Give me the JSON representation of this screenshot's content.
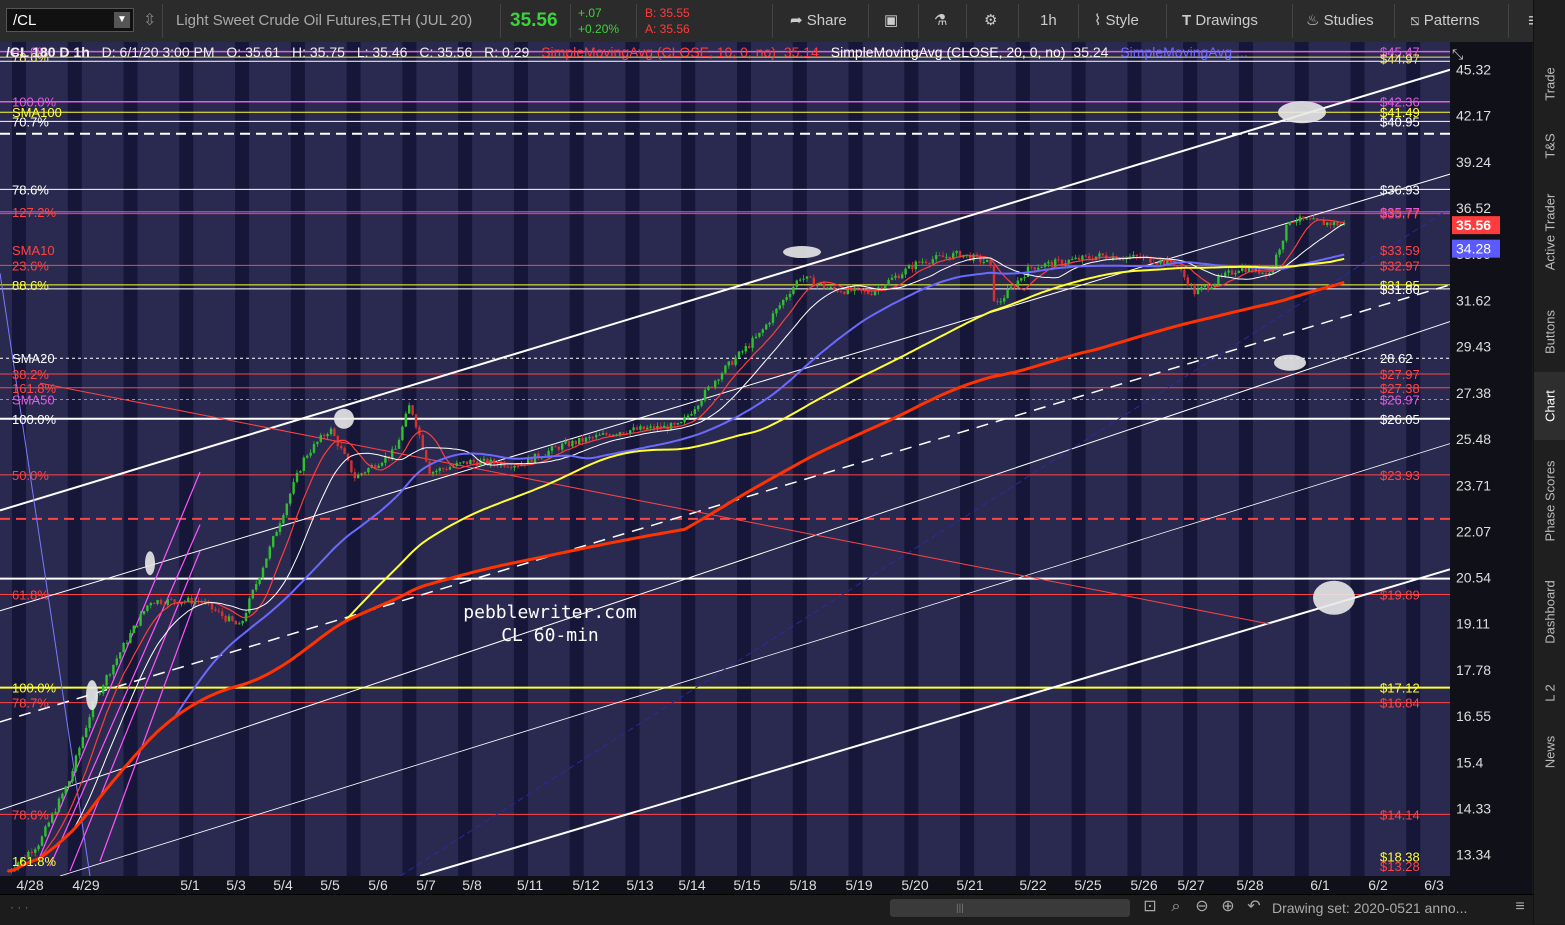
{
  "toolbar": {
    "symbol": "/CL",
    "instrument": "Light Sweet Crude Oil Futures,ETH (JUL 20)",
    "last": "35.56",
    "change": "+.07",
    "change_pct": "+0.20%",
    "bid": "B: 35.55",
    "ask": "A: 35.56",
    "share": "Share",
    "interval": "1h",
    "style": "Style",
    "drawings": "Drawings",
    "studies": "Studies",
    "patterns": "Patterns"
  },
  "header": {
    "title": "/CL 180 D 1h",
    "date": "D: 6/1/20 3:00 PM",
    "open": "O: 35.61",
    "high": "H: 35.75",
    "low": "L: 35.46",
    "close": "C: 35.56",
    "range": "R: 0.29",
    "sma10": "SimpleMovingAvg (CLOSE, 10, 0, no)",
    "sma10_val": "35.14",
    "sma20": "SimpleMovingAvg (CLOSE, 20, 0, no)",
    "sma20_val": "35.24",
    "sma_more": "SimpleMovingAvg ..."
  },
  "side_tabs": [
    "Trade",
    "T&S",
    "Active Trader",
    "Buttons",
    "Chart",
    "Phase Scores",
    "Dashboard",
    "L 2",
    "News"
  ],
  "watermark": {
    "line1": "pebblewriter.com",
    "line2": "CL 60-min"
  },
  "footer": {
    "drawing_set": "Drawing set: 2020-0521 anno..."
  },
  "colors": {
    "background": "#2a2a50",
    "candle_up": "#2fbf2f",
    "candle_down": "#d83030",
    "sma10": "#ff3b3b",
    "sma20": "#ffffff",
    "sma50": "#6a6aff",
    "sma100": "#ffff33",
    "sma200": "#ff3300",
    "last_price": "#ff3b3b",
    "sma_price": "#5a5aff"
  },
  "chart_data": {
    "type": "line",
    "ylim": [
      12.9,
      47.3
    ],
    "y_ticks": [
      45.32,
      42.17,
      39.24,
      36.52,
      33.99,
      31.62,
      29.43,
      27.38,
      25.48,
      23.71,
      22.07,
      20.54,
      19.11,
      17.78,
      16.55,
      15.4,
      14.33,
      13.34
    ],
    "x_ticks": [
      "4/28",
      "4/29",
      "5/1",
      "5/3",
      "5/4",
      "5/5",
      "5/6",
      "5/7",
      "5/8",
      "5/11",
      "5/12",
      "5/13",
      "5/14",
      "5/15",
      "5/18",
      "5/19",
      "5/20",
      "5/21",
      "5/22",
      "5/25",
      "5/26",
      "5/27",
      "5/28",
      "6/1",
      "6/2",
      "6/3"
    ],
    "last_price": "35.56",
    "sma_price": "34.28",
    "right_labels": [
      {
        "text": "$45.47",
        "color": "#e35be3",
        "y": 46.6
      },
      {
        "text": "$44.97",
        "color": "#f0e86a",
        "y": 46.1
      },
      {
        "text": "$42.36",
        "color": "#e35be3",
        "y": 43.1
      },
      {
        "text": "$41.49",
        "color": "#ffff33",
        "y": 42.4
      },
      {
        "text": "$40.95",
        "color": "#ffffff",
        "y": 41.8
      },
      {
        "text": "$36.93",
        "color": "#ffffff",
        "y": 37.6
      },
      {
        "text": "$35.77",
        "color": "#e35be3",
        "y": 36.3
      },
      {
        "text": "$35.77",
        "color": "#ff4444",
        "y": 36.2
      },
      {
        "text": "$33.59",
        "color": "#ff4444",
        "y": 34.2
      },
      {
        "text": "$32.97",
        "color": "#ff4444",
        "y": 33.4
      },
      {
        "text": "$31.95",
        "color": "#ffff33",
        "y": 32.4
      },
      {
        "text": "$31.86",
        "color": "#ffffff",
        "y": 32.2
      },
      {
        "text": "28.62",
        "color": "#ffffff",
        "y": 28.9
      },
      {
        "text": "$27.97",
        "color": "#ff4444",
        "y": 28.2
      },
      {
        "text": "$27.38",
        "color": "#ff4444",
        "y": 27.6
      },
      {
        "text": "$26.97",
        "color": "#e35be3",
        "y": 27.1
      },
      {
        "text": "$26.05",
        "color": "#ffffff",
        "y": 26.3
      },
      {
        "text": "$23.93",
        "color": "#ff4444",
        "y": 24.1
      },
      {
        "text": "$19.89",
        "color": "#ff4444",
        "y": 20.0
      },
      {
        "text": "$17.12",
        "color": "#ffff33",
        "y": 17.3
      },
      {
        "text": "$16.84",
        "color": "#ff4444",
        "y": 16.9
      },
      {
        "text": "$14.14",
        "color": "#ff4444",
        "y": 14.2
      },
      {
        "text": "$18.38",
        "color": "#ffff33",
        "y": 13.3
      },
      {
        "text": "$13.28",
        "color": "#ff4444",
        "y": 13.1
      }
    ],
    "left_labels": [
      {
        "text": "61.8%",
        "color": "#e35be3",
        "y": 46.6
      },
      {
        "text": "78.6%",
        "color": "#f0e86a",
        "y": 46.2
      },
      {
        "text": "100.0%",
        "color": "#e35be3",
        "y": 43.1
      },
      {
        "text": "SMA100",
        "color": "#ffff33",
        "y": 42.4
      },
      {
        "text": "70.7%",
        "color": "#ffffff",
        "y": 41.8
      },
      {
        "text": "78.6%",
        "color": "#ffffff",
        "y": 37.6
      },
      {
        "text": "127.2%",
        "color": "#ff4444",
        "y": 36.3
      },
      {
        "text": "SMA10",
        "color": "#ff4444",
        "y": 34.2
      },
      {
        "text": "23.6%",
        "color": "#ff4444",
        "y": 33.4
      },
      {
        "text": "88.6%",
        "color": "#ffff33",
        "y": 32.4
      },
      {
        "text": "SMA20",
        "color": "#ffffff",
        "y": 28.9
      },
      {
        "text": "38.2%",
        "color": "#ff4444",
        "y": 28.2
      },
      {
        "text": "161.8%",
        "color": "#ff4444",
        "y": 27.6
      },
      {
        "text": "SMA50",
        "color": "#e35be3",
        "y": 27.1
      },
      {
        "text": "100.0%",
        "color": "#ffffff",
        "y": 26.3
      },
      {
        "text": "50.0%",
        "color": "#ff4444",
        "y": 24.1
      },
      {
        "text": "61.8%",
        "color": "#ff4444",
        "y": 20.0
      },
      {
        "text": "100.0%",
        "color": "#ffff33",
        "y": 17.3
      },
      {
        "text": "78.7%",
        "color": "#ff4444",
        "y": 16.9
      },
      {
        "text": "78.6%",
        "color": "#ff4444",
        "y": 14.2
      },
      {
        "text": "161.8%",
        "color": "#ffff33",
        "y": 13.2
      }
    ]
  }
}
